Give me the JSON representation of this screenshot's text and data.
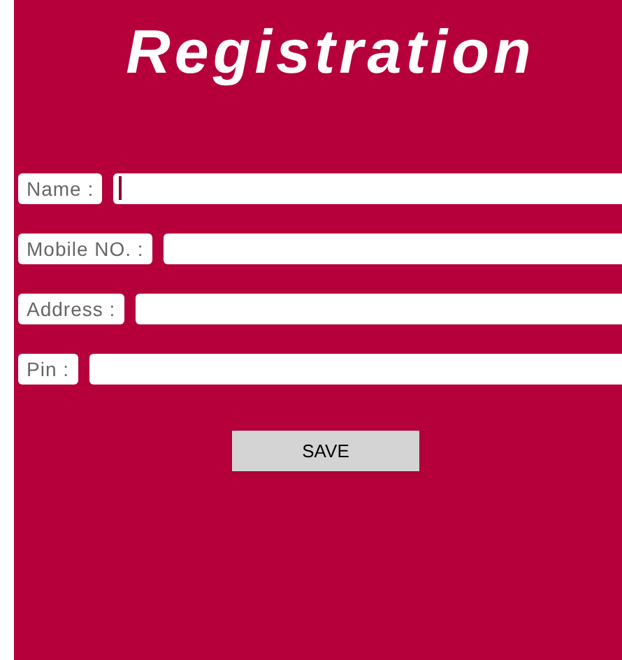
{
  "title": "Registration",
  "fields": [
    {
      "label": "Name :",
      "focused": true
    },
    {
      "label": "Mobile NO. :",
      "focused": false
    },
    {
      "label": "Address :",
      "focused": false
    },
    {
      "label": "Pin :",
      "focused": false
    }
  ],
  "button": "SAVE"
}
